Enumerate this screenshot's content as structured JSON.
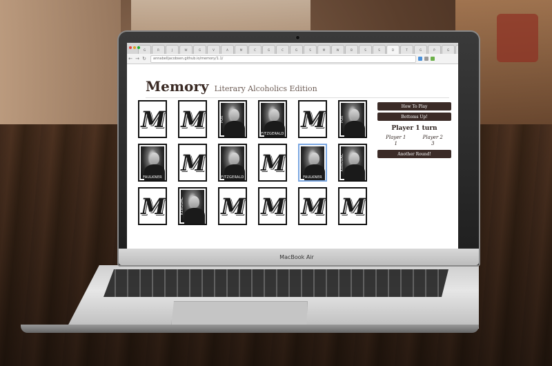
{
  "device": {
    "brand_label": "MacBook Air"
  },
  "browser": {
    "tabs": [
      "G",
      "R",
      "J",
      "W",
      "G",
      "V",
      "A",
      "M",
      "C",
      "G",
      "C",
      "G",
      "S",
      "M",
      "W",
      "B",
      "S",
      "S",
      "D",
      "T",
      "G",
      "P",
      "G",
      "M"
    ],
    "active_tab_index": 18,
    "url": "annabelljacobsen.github.io/memory/1.1/",
    "nav": {
      "back": "←",
      "forward": "→",
      "reload": "↻"
    }
  },
  "page": {
    "title": "Memory",
    "subtitle": "Literary Alcoholics Edition"
  },
  "cards": [
    {
      "face": "back"
    },
    {
      "face": "back"
    },
    {
      "face": "portrait",
      "name": "POE",
      "label_style": "vertical"
    },
    {
      "face": "portrait",
      "name": "FITZGERALD",
      "label_style": "bottom"
    },
    {
      "face": "back"
    },
    {
      "face": "portrait",
      "name": "POE",
      "label_style": "vertical"
    },
    {
      "face": "portrait",
      "name": "FAULKNER",
      "label_style": "bottom"
    },
    {
      "face": "back"
    },
    {
      "face": "portrait",
      "name": "FITZGERALD",
      "label_style": "bottom"
    },
    {
      "face": "back"
    },
    {
      "face": "portrait",
      "name": "FAULKNER",
      "label_style": "bottom",
      "selected": true
    },
    {
      "face": "portrait",
      "name": "KEROUAC",
      "label_style": "vertical"
    },
    {
      "face": "back"
    },
    {
      "face": "portrait",
      "name": "KEROUAC",
      "label_style": "vertical"
    },
    {
      "face": "back"
    },
    {
      "face": "back"
    },
    {
      "face": "back"
    },
    {
      "face": "back"
    }
  ],
  "card_back_glyph": "M",
  "controls": {
    "how_to_play": "How To Play",
    "bottoms_up": "Bottoms Up!",
    "turn_status": "Player 1 turn",
    "player1_label": "Player 1",
    "player1_score": "1",
    "player2_label": "Player 2",
    "player2_score": "3",
    "another_round": "Another Round!"
  },
  "colors": {
    "button_bg": "#3b2b27",
    "selected_border": "#7aa6e0",
    "title": "#3a2a24"
  }
}
